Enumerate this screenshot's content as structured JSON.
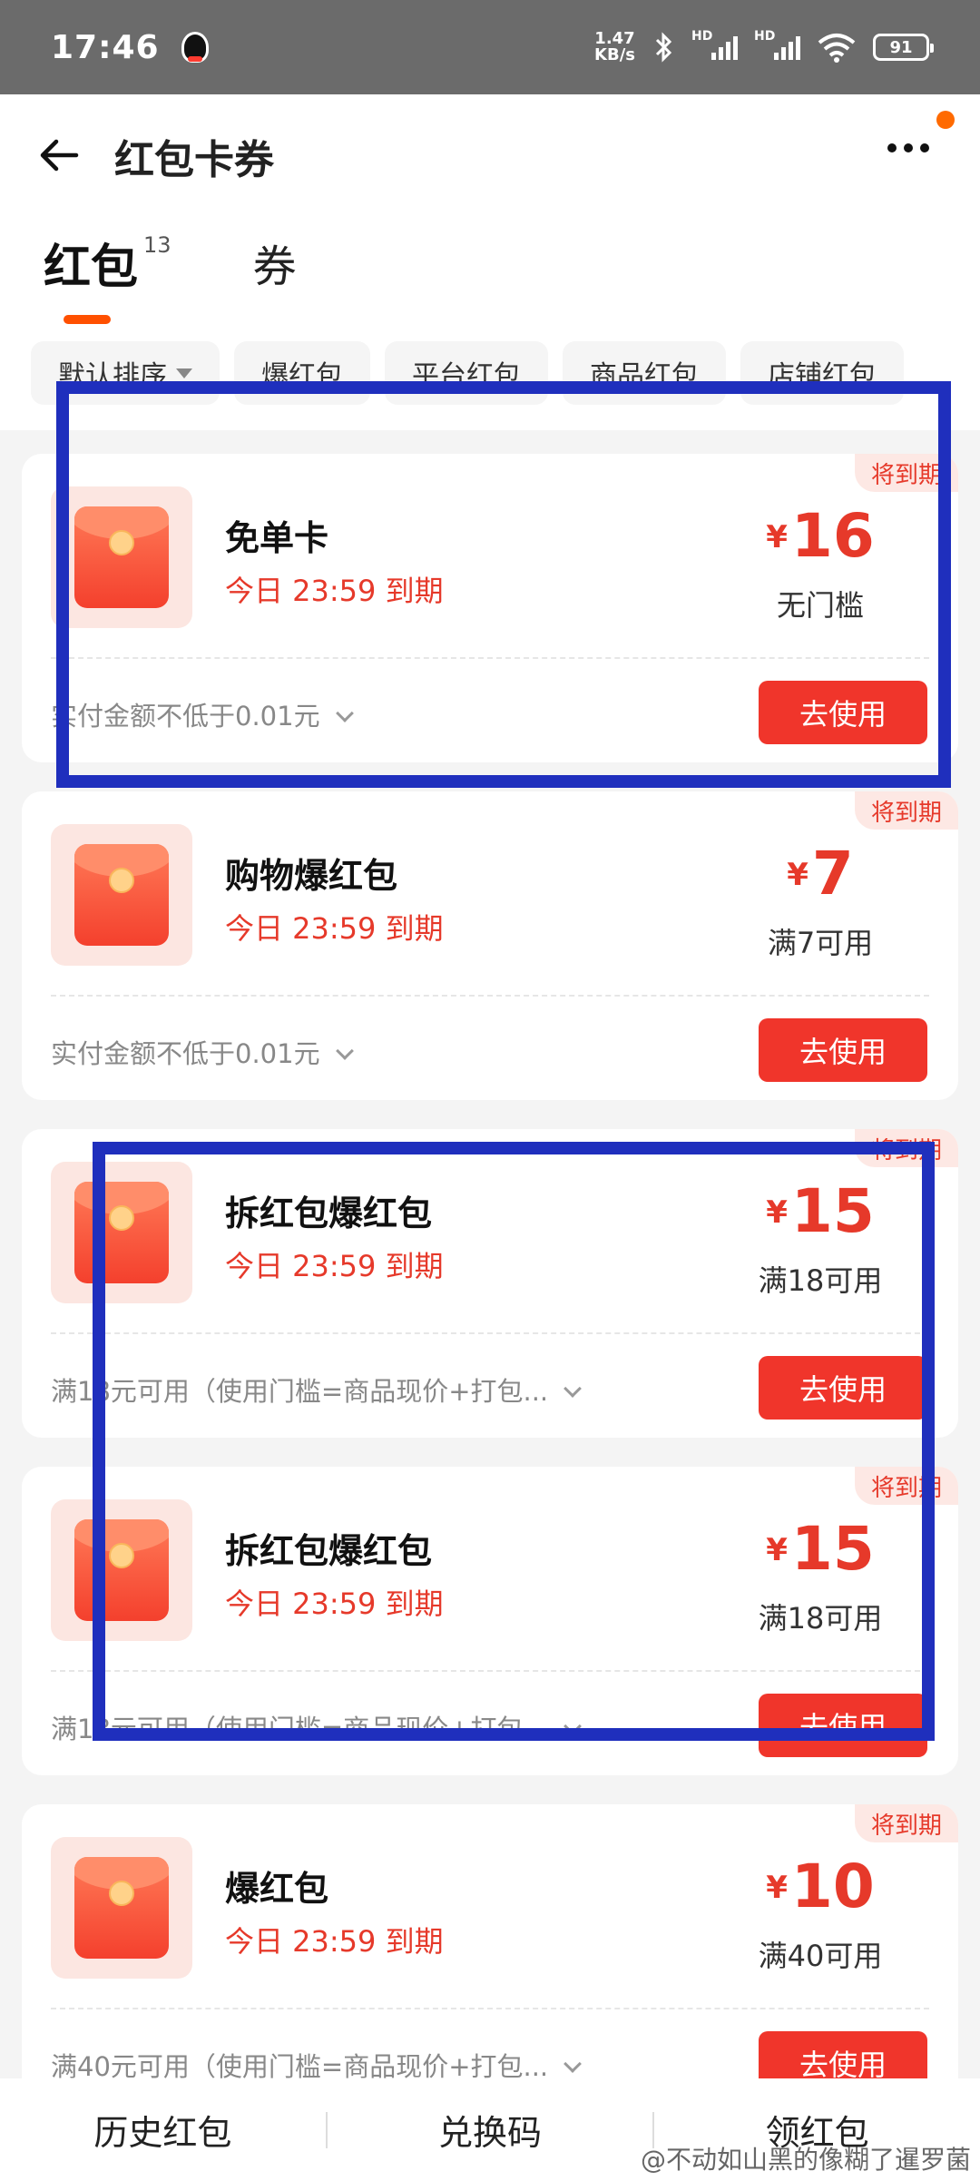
{
  "status": {
    "time": "17:46",
    "net_speed_value": "1.47",
    "net_speed_unit": "KB/s",
    "hd1": "HD",
    "hd2": "HD",
    "battery": "91"
  },
  "header": {
    "title": "红包卡券",
    "tabs": [
      {
        "label": "红包",
        "count": "13"
      },
      {
        "label": "券"
      }
    ],
    "filters": [
      "默认排序",
      "爆红包",
      "平台红包",
      "商品红包",
      "店铺红包"
    ]
  },
  "cards": [
    {
      "badge": "将到期",
      "name": "免单卡",
      "expire": "今日 23:59 到期",
      "currency": "¥",
      "amount": "16",
      "condition": "无门槛",
      "rule": "实付金额不低于0.01元",
      "button": "去使用"
    },
    {
      "badge": "将到期",
      "name": "购物爆红包",
      "expire": "今日 23:59 到期",
      "currency": "¥",
      "amount": "7",
      "condition": "满7可用",
      "rule": "实付金额不低于0.01元",
      "button": "去使用"
    },
    {
      "badge": "将到期",
      "name": "拆红包爆红包",
      "expire": "今日 23:59 到期",
      "currency": "¥",
      "amount": "15",
      "condition": "满18可用",
      "rule": "满18元可用（使用门槛=商品现价+打包...",
      "button": "去使用"
    },
    {
      "badge": "将到期",
      "name": "拆红包爆红包",
      "expire": "今日 23:59 到期",
      "currency": "¥",
      "amount": "15",
      "condition": "满18可用",
      "rule": "满18元可用（使用门槛=商品现价+打包...",
      "button": "去使用"
    },
    {
      "badge": "将到期",
      "name": "爆红包",
      "expire": "今日 23:59 到期",
      "currency": "¥",
      "amount": "10",
      "condition": "满40可用",
      "rule": "满40元可用（使用门槛=商品现价+打包...",
      "button": "去使用"
    }
  ],
  "bottom": {
    "items": [
      "历史红包",
      "兑换码",
      "领红包"
    ]
  },
  "watermark": "@不动如山黑的像糊了暹罗菌",
  "colors": {
    "accent": "#f0352b",
    "annotation": "#1f2fbd",
    "tab_indicator": "#ff5000"
  }
}
